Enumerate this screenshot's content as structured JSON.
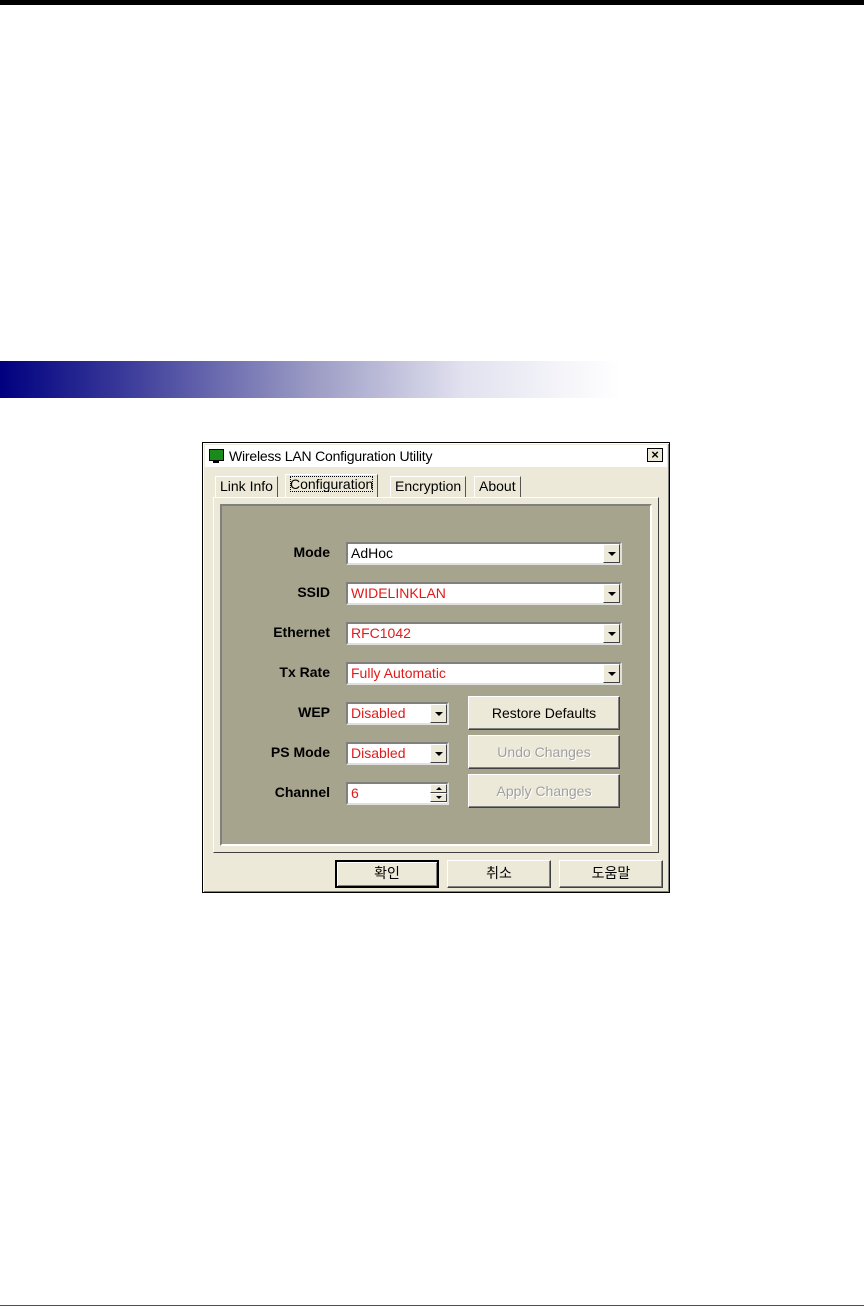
{
  "window": {
    "title": "Wireless LAN Configuration Utility",
    "close_glyph": "×"
  },
  "tabs": [
    {
      "label": "Link Info"
    },
    {
      "label": "Configuration"
    },
    {
      "label": "Encryption"
    },
    {
      "label": "About"
    }
  ],
  "fields": {
    "mode": {
      "label": "Mode",
      "value": "AdHoc"
    },
    "ssid": {
      "label": "SSID",
      "value": "WIDELINKLAN"
    },
    "ethernet": {
      "label": "Ethernet",
      "value": "RFC1042"
    },
    "tx_rate": {
      "label": "Tx Rate",
      "value": "Fully Automatic"
    },
    "wep": {
      "label": "WEP",
      "value": "Disabled"
    },
    "ps_mode": {
      "label": "PS Mode",
      "value": "Disabled"
    },
    "channel": {
      "label": "Channel",
      "value": "6"
    }
  },
  "actions": {
    "restore": "Restore Defaults",
    "undo": "Undo Changes",
    "apply": "Apply Changes"
  },
  "dialog_buttons": {
    "ok": "확인",
    "cancel": "취소",
    "help": "도움말"
  },
  "colors": {
    "changed_value": "#e01a1a",
    "panel": "#a7a48e",
    "banner": "#000080"
  }
}
